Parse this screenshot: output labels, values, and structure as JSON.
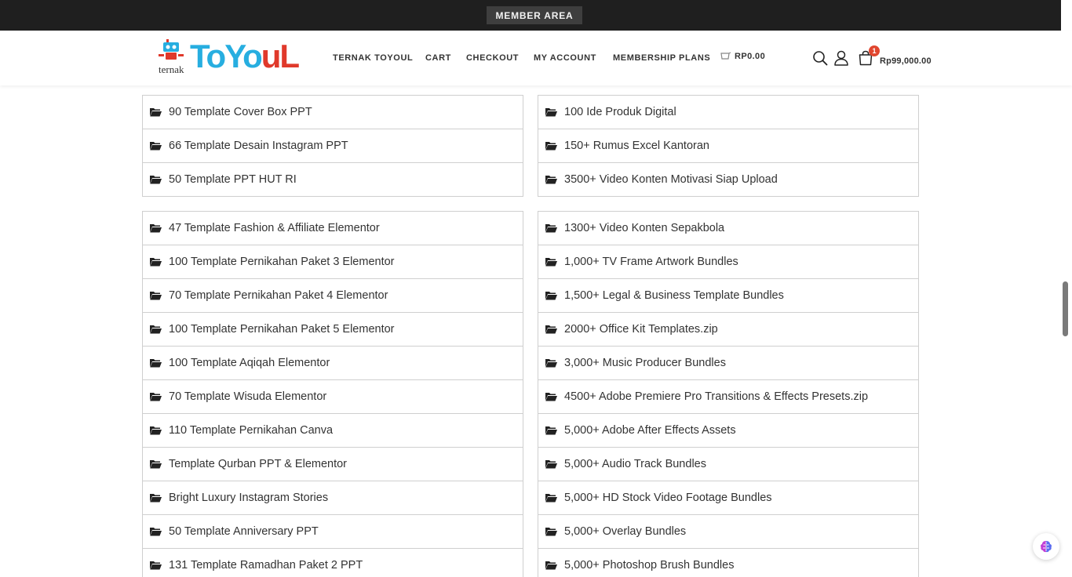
{
  "topbar": {
    "member_area": "MEMBER AREA"
  },
  "logo": {
    "small_text": "ternak",
    "big_text_blue": "ToYo",
    "big_text_red": "uL"
  },
  "nav": {
    "items": [
      "TERNAK TOYOUL",
      "CART",
      "CHECKOUT",
      "MY ACCOUNT",
      "MEMBERSHIP PLANS"
    ],
    "mini_cart_total": "RP0.00"
  },
  "header_icons": {
    "search": "search-icon",
    "account": "user-icon",
    "cart": "shopping-bag-icon"
  },
  "cart": {
    "count": "1",
    "total": "Rp99,000.00"
  },
  "colors": {
    "topbar": "#1f1f1f",
    "logo_blue": "#27aee0",
    "logo_red": "#e0392b",
    "badge": "#e0462f"
  },
  "left_top_list": [
    "90 Template Cover Box PPT",
    "66 Template Desain Instagram PPT",
    "50 Template PPT HUT RI"
  ],
  "right_top_list": [
    "100 Ide Produk Digital",
    "150+ Rumus Excel Kantoran",
    "3500+ Video Konten Motivasi Siap Upload"
  ],
  "left_list": [
    "47 Template Fashion & Affiliate Elementor",
    "100 Template Pernikahan Paket 3 Elementor",
    "70 Template Pernikahan Paket 4 Elementor",
    "100 Template Pernikahan Paket 5 Elementor",
    "100 Template Aqiqah Elementor",
    "70 Template Wisuda Elementor",
    "110 Template Pernikahan Canva",
    "Template Qurban PPT & Elementor",
    "Bright Luxury Instagram Stories",
    "50 Template Anniversary PPT",
    "131 Template Ramadhan Paket 2 PPT"
  ],
  "right_list": [
    "1300+ Video Konten Sepakbola",
    "1,000+ TV Frame Artwork Bundles",
    "1,500+ Legal & Business Template Bundles",
    "2000+ Office Kit Templates.zip",
    "3,000+ Music Producer Bundles",
    "4500+ Adobe Premiere Pro Transitions & Effects Presets.zip",
    "5,000+ Adobe After Effects Assets",
    "5,000+ Audio Track Bundles",
    "5,000+ HD Stock Video Footage Bundles",
    "5,000+ Overlay Bundles",
    "5,000+ Photoshop Brush Bundles"
  ]
}
